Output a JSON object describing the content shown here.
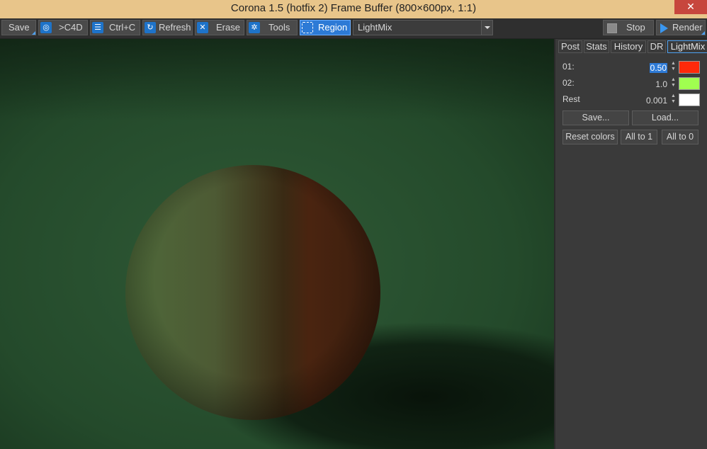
{
  "window": {
    "title": "Corona 1.5 (hotfix 2) Frame Buffer (800×600px, 1:1)",
    "close_glyph": "✕"
  },
  "toolbar": {
    "save": "Save",
    "to_c4d": ">C4D",
    "ctrl_c": "Ctrl+C",
    "refresh": "Refresh",
    "erase": "Erase",
    "tools": "Tools",
    "region": "Region",
    "channel_select": "LightMix",
    "stop": "Stop",
    "render": "Render",
    "icons": {
      "to_c4d": "c4d-logo-icon",
      "ctrl_c": "copy-icon",
      "refresh": "refresh-icon",
      "erase": "erase-icon",
      "tools": "gear-icon",
      "region": "region-icon",
      "stop": "stop-icon",
      "render": "play-icon"
    }
  },
  "panel": {
    "tabs": [
      "Post",
      "Stats",
      "History",
      "DR",
      "LightMix"
    ],
    "active_tab": "LightMix",
    "lightmix": [
      {
        "name": "01:",
        "value": "0.50",
        "color": "#ff2a0a",
        "selected": true
      },
      {
        "name": "02:",
        "value": "1.0",
        "color": "#a0ff50",
        "selected": false
      },
      {
        "name": "Rest",
        "value": "0.001",
        "color": "#ffffff",
        "selected": false
      }
    ],
    "save_label": "Save...",
    "load_label": "Load...",
    "reset_colors": "Reset colors",
    "all_to_1": "All to 1",
    "all_to_0": "All to 0"
  },
  "colors": {
    "title_bar": "#e8c58a",
    "accent": "#2d7ad6",
    "background_render": "#2b4a2f"
  }
}
